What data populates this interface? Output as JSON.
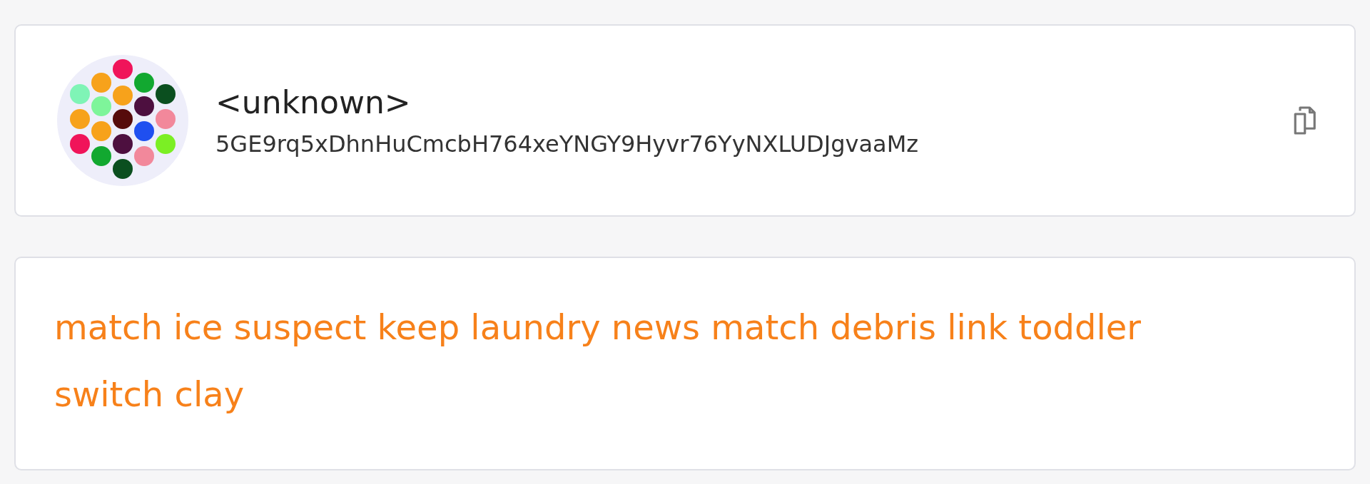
{
  "account": {
    "name": "<unknown>",
    "address": "5GE9rq5xDhnHuCmcbH764xeYNGY9Hyvr76YyNXLUDJgvaaMz"
  },
  "mnemonic": "match ice suspect keep laundry news match debris link toddler switch clay"
}
